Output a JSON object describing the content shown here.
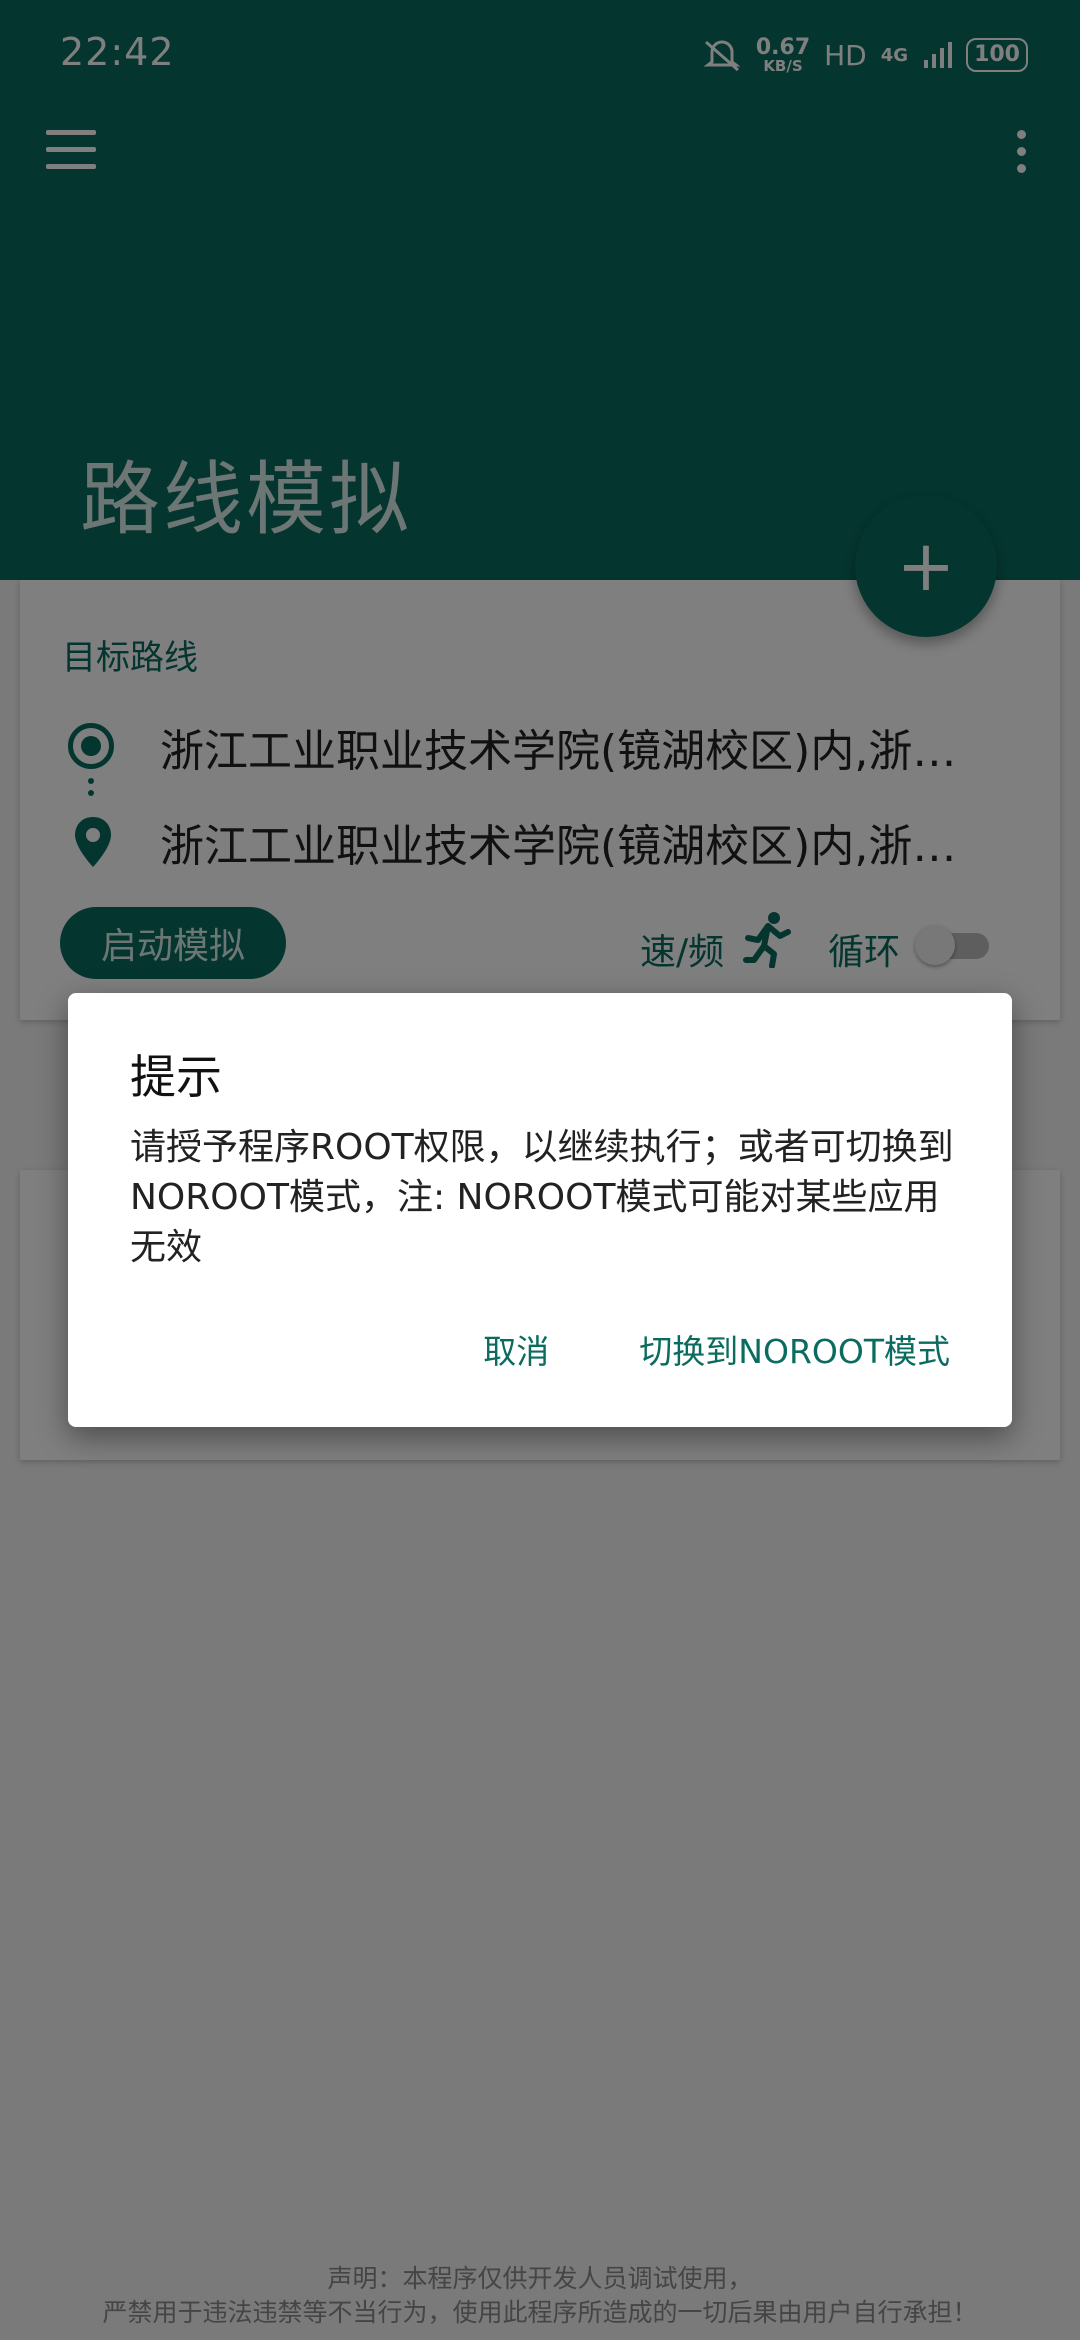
{
  "status_bar": {
    "time": "22:42",
    "net_speed_value": "0.67",
    "net_speed_unit": "KB/S",
    "hd": "HD",
    "signal": "4G",
    "battery": "100"
  },
  "app_bar": {
    "title": "路线模拟",
    "fab_icon": "+"
  },
  "route_card": {
    "label": "目标路线",
    "start": "浙江工业职业技术学院(镜湖校区)内,浙江省绍兴市越城区",
    "end": "浙江工业职业技术学院(镜湖校区)内,浙江省绍兴市越城区",
    "start_button": "启动模拟",
    "speed_label": "速/频",
    "loop_label": "循环"
  },
  "dialog": {
    "title": "提示",
    "message": "请授予程序ROOT权限，以继续执行；或者可切换到NOROOT模式，注: NOROOT模式可能对某些应用无效",
    "cancel": "取消",
    "confirm": "切换到NOROOT模式"
  },
  "disclaimer": {
    "line1": "声明：本程序仅供开发人员调试使用，",
    "line2": "严禁用于违法违禁等不当行为，使用此程序所造成的一切后果由用户自行承担！"
  },
  "colors": {
    "primary": "#0a6b5f",
    "title_text": "#d8ece8"
  }
}
